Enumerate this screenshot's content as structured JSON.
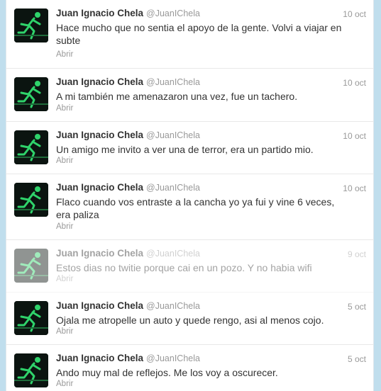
{
  "tweets": [
    {
      "name": "Juan Ignacio Chela",
      "handle": "@JuanIChela",
      "date": "10 oct",
      "text": "Hace mucho que no sentia el apoyo de la gente. Volvi a viajar en subte",
      "action": "Abrir"
    },
    {
      "name": "Juan Ignacio Chela",
      "handle": "@JuanIChela",
      "date": "10 oct",
      "text": "A mi también me amenazaron una vez, fue un tachero.",
      "action": "Abrir"
    },
    {
      "name": "Juan Ignacio Chela",
      "handle": "@JuanIChela",
      "date": "10 oct",
      "text": "Un amigo me invito a ver una de terror, era un partido mio.",
      "action": "Abrir"
    },
    {
      "name": "Juan Ignacio Chela",
      "handle": "@JuanIChela",
      "date": "10 oct",
      "text": "Flaco cuando vos entraste a la cancha yo ya fui y vine 6 veces, era paliza",
      "action": "Abrir"
    },
    {
      "name": "Juan Ignacio Chela",
      "handle": "@JuanIChela",
      "date": "9 oct",
      "text": "Estos dias no twitie porque cai en un pozo. Y no habia wifi",
      "action": "Abrir"
    },
    {
      "name": "Juan Ignacio Chela",
      "handle": "@JuanIChela",
      "date": "5 oct",
      "text": "Ojala me atropelle un auto y quede rengo, asi al menos cojo.",
      "action": "Abrir"
    },
    {
      "name": "Juan Ignacio Chela",
      "handle": "@JuanIChela",
      "date": "5 oct",
      "text": "Ando muy mal de reflejos. Me los voy a oscurecer.",
      "action": "Abrir"
    }
  ],
  "avatar_icon": "running-man-icon",
  "colors": {
    "background": "#c0deed",
    "name": "#333333",
    "muted": "#999999",
    "avatar_bg": "#0b1410",
    "avatar_figure": "#2fd36b"
  }
}
